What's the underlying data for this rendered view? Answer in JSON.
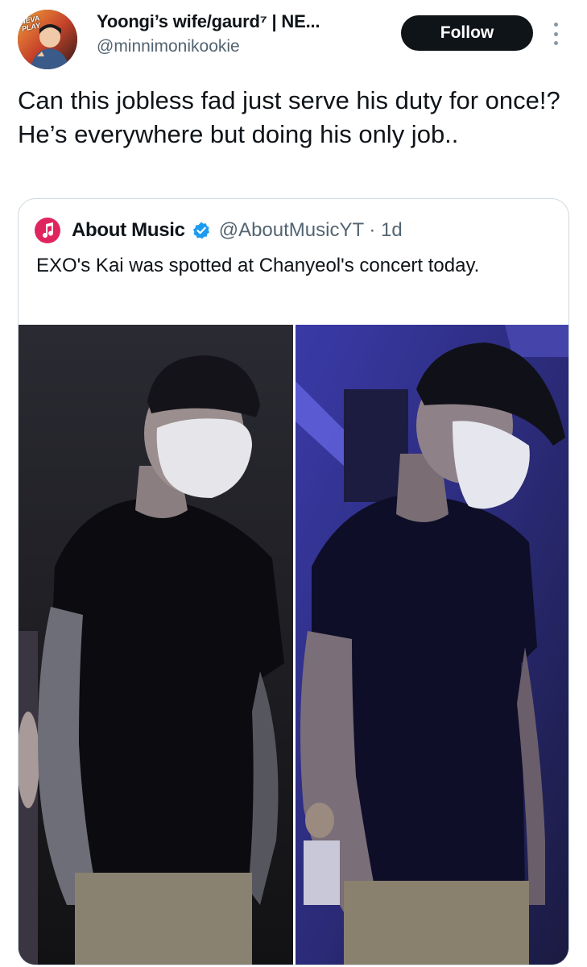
{
  "author": {
    "display_name": "Yoongi’s wife/gaurd⁷ | NE...",
    "handle": "@minnimonikookie",
    "avatar_badge_text": "NEVA PLAY"
  },
  "follow_label": "Follow",
  "more_icon": "more-vertical-icon",
  "tweet_text": "Can this jobless fad just serve his duty for once!? He’s everywhere but doing his only job..",
  "quote": {
    "name": "About Music",
    "handle_time": "@AboutMusicYT · 1d",
    "text": "EXO's Kai was spotted at Chanyeol's concert today.",
    "icon": "music-note-icon",
    "verified_icon": "verified-badge-icon",
    "verified_color": "#1d9bf0",
    "photos": [
      {
        "name": "photo-left"
      },
      {
        "name": "photo-right"
      }
    ]
  },
  "colors": {
    "text_primary": "#0f1419",
    "text_secondary": "#536471",
    "border": "#cfd9de",
    "button_bg": "#0f1419",
    "music_icon_bg": "#e0245e"
  }
}
